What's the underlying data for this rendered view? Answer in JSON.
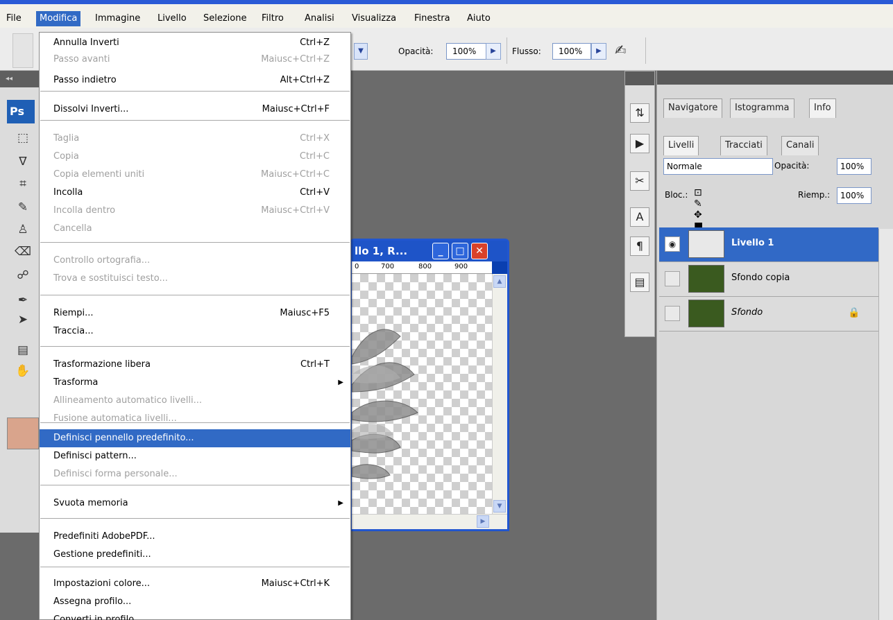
{
  "menubar": {
    "items": [
      "File",
      "Modifica",
      "Immagine",
      "Livello",
      "Selezione",
      "Filtro",
      "Analisi",
      "Visualizza",
      "Finestra",
      "Aiuto"
    ]
  },
  "options_bar": {
    "opacity_label": "Opacità:",
    "opacity_value": "100%",
    "flow_label": "Flusso:",
    "flow_value": "100%"
  },
  "toolbox": {
    "logo": "Ps",
    "foreground_color": "#d9a48c"
  },
  "edit_menu": {
    "items": [
      {
        "label": "Annulla Inverti",
        "shortcut": "Ctrl+Z",
        "enabled": true
      },
      {
        "label": "Passo avanti",
        "shortcut": "Maiusc+Ctrl+Z",
        "enabled": false
      },
      {
        "label": "Passo indietro",
        "shortcut": "Alt+Ctrl+Z",
        "enabled": true
      },
      {
        "label": "Dissolvi Inverti...",
        "shortcut": "Maiusc+Ctrl+F",
        "enabled": true
      },
      {
        "label": "Taglia",
        "shortcut": "Ctrl+X",
        "enabled": false
      },
      {
        "label": "Copia",
        "shortcut": "Ctrl+C",
        "enabled": false
      },
      {
        "label": "Copia elementi uniti",
        "shortcut": "Maiusc+Ctrl+C",
        "enabled": false
      },
      {
        "label": "Incolla",
        "shortcut": "Ctrl+V",
        "enabled": true
      },
      {
        "label": "Incolla dentro",
        "shortcut": "Maiusc+Ctrl+V",
        "enabled": false
      },
      {
        "label": "Cancella",
        "shortcut": "",
        "enabled": false
      },
      {
        "label": "Controllo ortografia...",
        "shortcut": "",
        "enabled": false
      },
      {
        "label": "Trova e sostituisci testo...",
        "shortcut": "",
        "enabled": false
      },
      {
        "label": "Riempi...",
        "shortcut": "Maiusc+F5",
        "enabled": true
      },
      {
        "label": "Traccia...",
        "shortcut": "",
        "enabled": true
      },
      {
        "label": "Trasformazione libera",
        "shortcut": "Ctrl+T",
        "enabled": true
      },
      {
        "label": "Trasforma",
        "shortcut": "",
        "enabled": true,
        "submenu": true
      },
      {
        "label": "Allineamento automatico livelli...",
        "shortcut": "",
        "enabled": false
      },
      {
        "label": "Fusione automatica livelli...",
        "shortcut": "",
        "enabled": false
      },
      {
        "label": "Definisci pennello predefinito...",
        "shortcut": "",
        "enabled": true,
        "highlighted": true
      },
      {
        "label": "Definisci pattern...",
        "shortcut": "",
        "enabled": true
      },
      {
        "label": "Definisci forma personale...",
        "shortcut": "",
        "enabled": false
      },
      {
        "label": "Svuota memoria",
        "shortcut": "",
        "enabled": true,
        "submenu": true
      },
      {
        "label": "Predefiniti AdobePDF...",
        "shortcut": "",
        "enabled": true
      },
      {
        "label": "Gestione predefiniti...",
        "shortcut": "",
        "enabled": true
      },
      {
        "label": "Impostazioni colore...",
        "shortcut": "Maiusc+Ctrl+K",
        "enabled": true
      },
      {
        "label": "Assegna profilo...",
        "shortcut": "",
        "enabled": true
      },
      {
        "label": "Converti in profilo...",
        "shortcut": "",
        "enabled": true
      }
    ]
  },
  "document_window": {
    "title": "llo 1, R...",
    "ruler_ticks": [
      "0",
      "700",
      "800",
      "900"
    ]
  },
  "panels": {
    "top_tabs": [
      "Navigatore",
      "Istogramma",
      "Info"
    ],
    "layer_tabs": [
      "Livelli",
      "Tracciati",
      "Canali"
    ],
    "blend_mode": "Normale",
    "opacity_label": "Opacità:",
    "opacity_value": "100%",
    "lock_label": "Bloc.:",
    "fill_label": "Riemp.:",
    "fill_value": "100%",
    "layers": [
      {
        "name": "Livello 1",
        "selected": true,
        "visible": true,
        "locked": false
      },
      {
        "name": "Sfondo copia",
        "selected": false,
        "visible": false,
        "locked": false
      },
      {
        "name": "Sfondo",
        "selected": false,
        "visible": false,
        "locked": true
      }
    ]
  }
}
